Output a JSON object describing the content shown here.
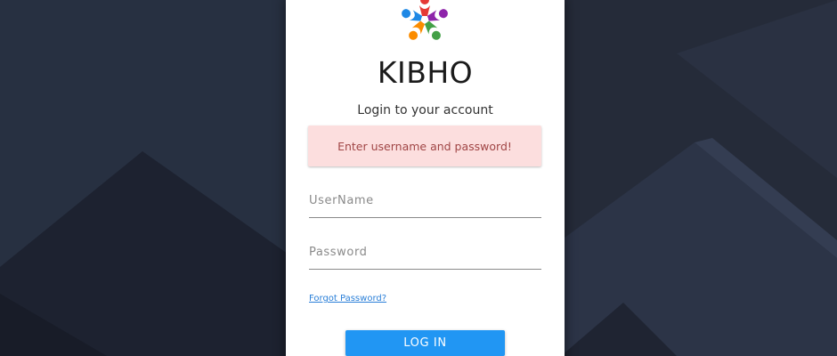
{
  "brand": {
    "name": "KIBHO",
    "logo_icon": "colorful-star-people-icon"
  },
  "login": {
    "subtitle": "Login to your account",
    "alert_message": "Enter username and password!",
    "username_placeholder": "UserName",
    "password_placeholder": "Password",
    "forgot_password_label": "Forgot Password?",
    "login_button_label": "LOG IN"
  },
  "colors": {
    "background": "#242a37",
    "alert_bg": "#fcdede",
    "alert_text": "#a04545",
    "primary_button": "#2196f3",
    "link": "#2a7fd8"
  }
}
